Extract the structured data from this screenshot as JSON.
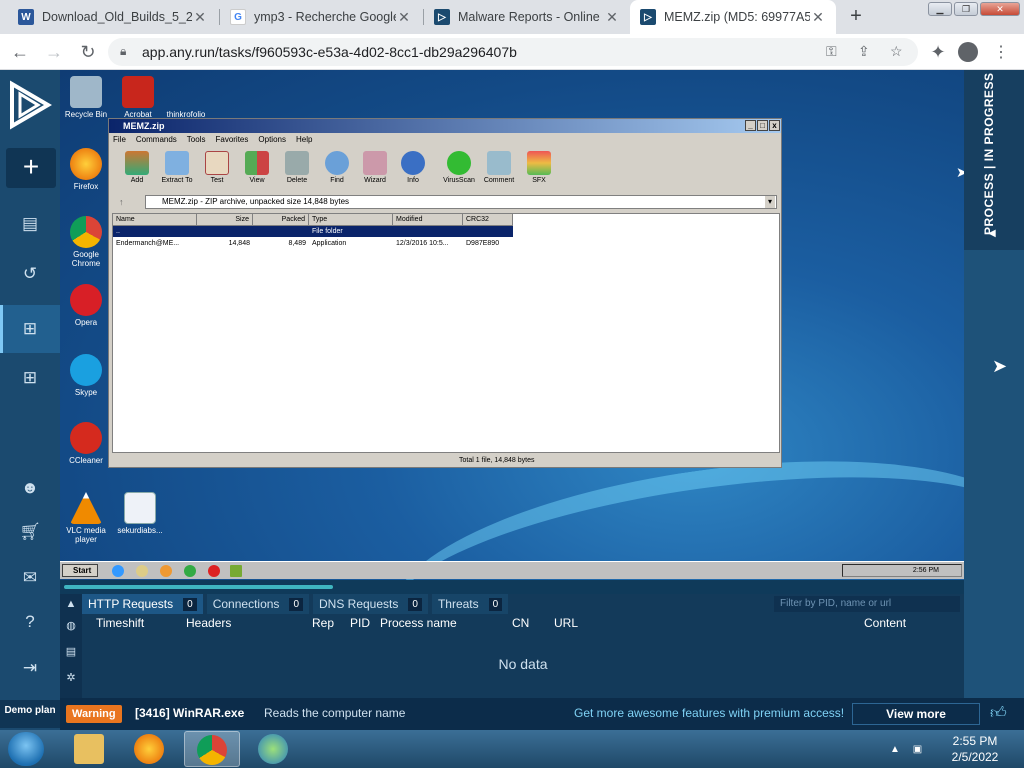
{
  "browser": {
    "tabs": [
      {
        "title": "Download_Old_Builds_5_2",
        "favicon": "word-icon"
      },
      {
        "title": "ymp3 - Recherche Google",
        "favicon": "google-icon"
      },
      {
        "title": "Malware Reports - Online",
        "favicon": "anyrun-icon"
      },
      {
        "title": "MEMZ.zip (MD5: 69977A5",
        "favicon": "anyrun-icon",
        "active": true
      }
    ],
    "url": "app.any.run/tasks/f960593c-e53a-4d02-8cc1-db29a296407b"
  },
  "sidebar": {
    "plus_label": "+",
    "demo_plan": "Demo plan"
  },
  "desktop": {
    "icons": [
      {
        "label": "Recycle Bin",
        "color": "#9fb7c9"
      },
      {
        "label": "Acrobat",
        "color": "#c8261c"
      },
      {
        "label": "thinkrofolio",
        "color": "#1b5ea1"
      },
      {
        "label": "Firefox",
        "color": "#e66000"
      },
      {
        "label": "Google Chrome",
        "color": "#2a9d3a"
      },
      {
        "label": "Opera",
        "color": "#d81f26"
      },
      {
        "label": "Skype",
        "color": "#1aa0e0"
      },
      {
        "label": "CCleaner",
        "color": "#d52a1e"
      },
      {
        "label": "VLC media player",
        "color": "#f08a00"
      },
      {
        "label": "sekurdiabs...",
        "color": "#eef2f8"
      }
    ]
  },
  "winrar": {
    "title": "MEMZ.zip",
    "menu": [
      "File",
      "Commands",
      "Tools",
      "Favorites",
      "Options",
      "Help"
    ],
    "tools": [
      "Add",
      "Extract To",
      "Test",
      "View",
      "Delete",
      "Find",
      "Wizard",
      "Info",
      "VirusScan",
      "Comment",
      "SFX"
    ],
    "path": "MEMZ.zip - ZIP archive, unpacked size 14,848 bytes",
    "columns": [
      "Name",
      "Size",
      "Packed",
      "Type",
      "Modified",
      "CRC32"
    ],
    "rows": [
      {
        "name": "..",
        "size": "",
        "packed": "",
        "type": "File folder",
        "modified": "",
        "crc": ""
      },
      {
        "name": "Endermanch@ME...",
        "size": "14,848",
        "packed": "8,489",
        "type": "Application",
        "modified": "12/3/2016 10:5...",
        "crc": "D987E890"
      }
    ],
    "status": "Total 1 file, 14,848 bytes"
  },
  "vm_taskbar": {
    "start": "Start",
    "time": "2:56 PM"
  },
  "right_panel": {
    "status": "PROCESS | IN PROGRESS"
  },
  "network": {
    "tabs": [
      {
        "label": "HTTP Requests",
        "count": "0",
        "active": true
      },
      {
        "label": "Connections",
        "count": "0"
      },
      {
        "label": "DNS Requests",
        "count": "0"
      },
      {
        "label": "Threats",
        "count": "0"
      }
    ],
    "filter_placeholder": "Filter by PID, name or url",
    "columns": [
      "Timeshift",
      "Headers",
      "Rep",
      "PID",
      "Process name",
      "CN",
      "URL",
      "Content"
    ],
    "empty": "No data",
    "progress": 0.3
  },
  "footer": {
    "badge": "Warning",
    "process": "[3416] WinRAR.exe",
    "message": "Reads the computer name",
    "promo": "Get more awesome features with premium access!",
    "view_more": "View more"
  },
  "host_taskbar": {
    "time": "2:55 PM",
    "date": "2/5/2022"
  }
}
